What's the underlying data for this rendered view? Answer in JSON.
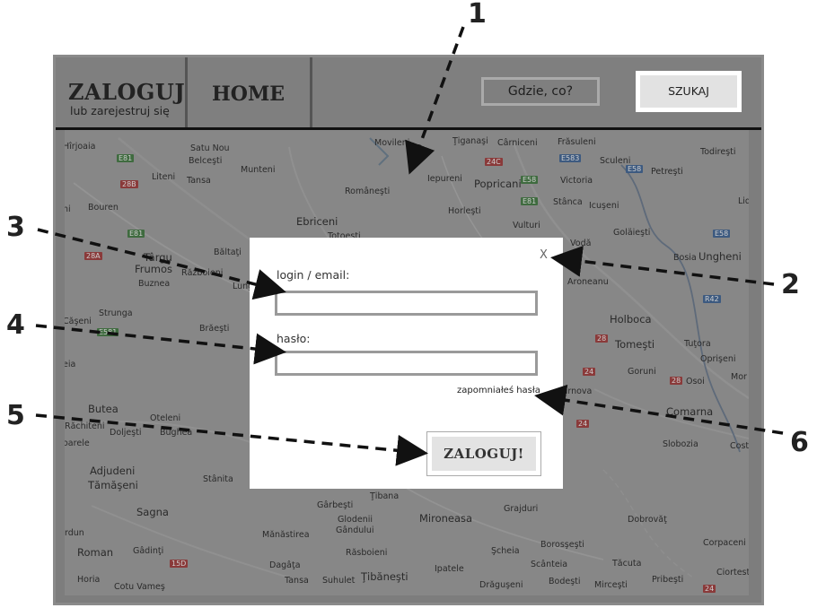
{
  "header": {
    "login_title": "ZALOGUJ",
    "register_subtitle": "lub zarejestruj się",
    "home_label": "HOME",
    "search_placeholder": "Gdzie, co?",
    "search_button": "SZUKAJ"
  },
  "map": {
    "places": [
      {
        "name": "Hîrjoaia",
        "big": false
      },
      {
        "name": "Satu Nou",
        "big": false
      },
      {
        "name": "Belceşti",
        "big": false
      },
      {
        "name": "Munteni",
        "big": false
      },
      {
        "name": "Movileni",
        "big": false
      },
      {
        "name": "Ţiganaşi",
        "big": false
      },
      {
        "name": "Cârniceni",
        "big": false
      },
      {
        "name": "Frăsuleni",
        "big": false
      },
      {
        "name": "Todireşti",
        "big": false
      },
      {
        "name": "Liteni",
        "big": false
      },
      {
        "name": "Tansa",
        "big": false
      },
      {
        "name": "Româneşti",
        "big": false
      },
      {
        "name": "Iepureni",
        "big": false
      },
      {
        "name": "Popricani",
        "big": false
      },
      {
        "name": "Victoria",
        "big": false
      },
      {
        "name": "Sculeni",
        "big": false
      },
      {
        "name": "Petreşti",
        "big": false
      },
      {
        "name": "Bouren",
        "big": false
      },
      {
        "name": "Horleşti",
        "big": false
      },
      {
        "name": "Stânca",
        "big": false
      },
      {
        "name": "Icuşeni",
        "big": false
      },
      {
        "name": "Ebriceni",
        "big": true
      },
      {
        "name": "Totoeşti",
        "big": false
      },
      {
        "name": "Vulturi",
        "big": false
      },
      {
        "name": "Goläieşti",
        "big": false
      },
      {
        "name": "Târgu",
        "big": true
      },
      {
        "name": "Frumos",
        "big": true
      },
      {
        "name": "Băltaţi",
        "big": false
      },
      {
        "name": "Războieni",
        "big": false
      },
      {
        "name": "Buznea",
        "big": false
      },
      {
        "name": "Lunga",
        "big": false
      },
      {
        "name": "Vodă",
        "big": false
      },
      {
        "name": "Bosia",
        "big": false
      },
      {
        "name": "Ungheni",
        "big": true
      },
      {
        "name": "Aroneanu",
        "big": false
      },
      {
        "name": "Strunga",
        "big": false
      },
      {
        "name": "Brăeşti",
        "big": false
      },
      {
        "name": "Holboca",
        "big": true
      },
      {
        "name": "Tomeşti",
        "big": true
      },
      {
        "name": "Tuţora",
        "big": false
      },
      {
        "name": "Oprişeni",
        "big": false
      },
      {
        "name": "Goruni",
        "big": false
      },
      {
        "name": "Osoi",
        "big": false
      },
      {
        "name": "Mor",
        "big": false
      },
      {
        "name": "Bârnova",
        "big": false
      },
      {
        "name": "Comarna",
        "big": true
      },
      {
        "name": "Butea",
        "big": true
      },
      {
        "name": "Oteleni",
        "big": false
      },
      {
        "name": "Răchiteni",
        "big": false
      },
      {
        "name": "Doljeşti",
        "big": false
      },
      {
        "name": "Bughea",
        "big": false
      },
      {
        "name": "oarele",
        "big": false
      },
      {
        "name": "Slobozia",
        "big": false
      },
      {
        "name": "Cost",
        "big": false
      },
      {
        "name": "Adjudeni",
        "big": true
      },
      {
        "name": "Tămăşeni",
        "big": true
      },
      {
        "name": "Stânita",
        "big": false
      },
      {
        "name": "Ţibana",
        "big": false
      },
      {
        "name": "Sagna",
        "big": true
      },
      {
        "name": "Gârbeşti",
        "big": false
      },
      {
        "name": "Glodenii",
        "big": false
      },
      {
        "name": "Gândului",
        "big": false
      },
      {
        "name": "Grajduri",
        "big": false
      },
      {
        "name": "Mironeasa",
        "big": true
      },
      {
        "name": "Dobrovăţ",
        "big": false
      },
      {
        "name": "rdun",
        "big": false
      },
      {
        "name": "Mănăstirea",
        "big": false
      },
      {
        "name": "Borosşeşti",
        "big": false
      },
      {
        "name": "Corpaceni",
        "big": false
      },
      {
        "name": "Roman",
        "big": true
      },
      {
        "name": "Gâdinţi",
        "big": false
      },
      {
        "name": "Răsboieni",
        "big": false
      },
      {
        "name": "Şcheia",
        "big": false
      },
      {
        "name": "Dagâţa",
        "big": false
      },
      {
        "name": "Ipatele",
        "big": false
      },
      {
        "name": "Scânteia",
        "big": false
      },
      {
        "name": "Tăcuta",
        "big": false
      },
      {
        "name": "Ciortest",
        "big": false
      },
      {
        "name": "Horia",
        "big": false
      },
      {
        "name": "Cotu Vameş",
        "big": false
      },
      {
        "name": "Tansa",
        "big": false
      },
      {
        "name": "Suhulet",
        "big": false
      },
      {
        "name": "Ţibăneşti",
        "big": true
      },
      {
        "name": "Drăguşeni",
        "big": false
      },
      {
        "name": "Bodeşti",
        "big": false
      },
      {
        "name": "Mirceşti",
        "big": false
      },
      {
        "name": "Pribeşti",
        "big": false
      },
      {
        "name": "Căşeni",
        "big": false
      },
      {
        "name": "eia",
        "big": false
      },
      {
        "name": "ni",
        "big": false
      },
      {
        "name": "Lid",
        "big": false
      }
    ],
    "roads": [
      {
        "label": "E81",
        "color": "g"
      },
      {
        "label": "28B",
        "color": "r"
      },
      {
        "label": "E583",
        "color": "b"
      },
      {
        "label": "E58",
        "color": "b"
      },
      {
        "label": "E58",
        "color": "g"
      },
      {
        "label": "24C",
        "color": "r"
      },
      {
        "label": "E81",
        "color": "g"
      },
      {
        "label": "E58",
        "color": "b"
      },
      {
        "label": "E81",
        "color": "g"
      },
      {
        "label": "28A",
        "color": "r"
      },
      {
        "label": "R42",
        "color": "b"
      },
      {
        "label": "E581",
        "color": "g"
      },
      {
        "label": "28",
        "color": "r"
      },
      {
        "label": "24",
        "color": "r"
      },
      {
        "label": "28",
        "color": "r"
      },
      {
        "label": "24",
        "color": "r"
      },
      {
        "label": "15D",
        "color": "r"
      },
      {
        "label": "24",
        "color": "r"
      }
    ]
  },
  "modal": {
    "close_label": "X",
    "login_label": "login / email:",
    "password_label": "hasło:",
    "forgot_label": "zapomniałeś hasła",
    "submit_label": "ZALOGUJ!"
  },
  "annotations": [
    "1",
    "2",
    "3",
    "4",
    "5",
    "6"
  ]
}
